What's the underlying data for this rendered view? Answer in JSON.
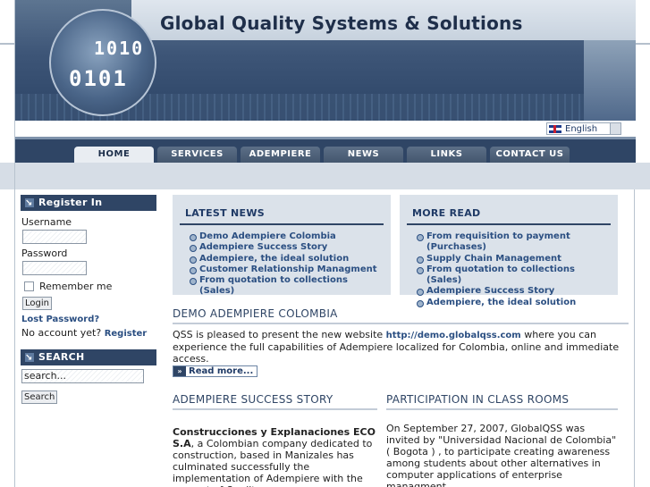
{
  "header": {
    "title": "Global Quality Systems & Solutions",
    "binary_line1": "1010",
    "binary_line2": "0101"
  },
  "language": {
    "selected": "English",
    "flag_icon": "uk-flag-icon"
  },
  "nav": {
    "tabs": [
      {
        "label": "HOME",
        "active": true
      },
      {
        "label": "SERVICES"
      },
      {
        "label": "ADEMPIERE"
      },
      {
        "label": "NEWS"
      },
      {
        "label": "LINKS"
      },
      {
        "label": "CONTACT US"
      }
    ]
  },
  "login": {
    "heading": "Register In",
    "username_label": "Username",
    "password_label": "Password",
    "remember_label": "Remember me",
    "login_button": "Login",
    "lost_password": "Lost Password?",
    "no_account": "No account yet?",
    "register_link": "Register"
  },
  "search": {
    "heading": "SEARCH",
    "placeholder": "search...",
    "button": "Search"
  },
  "latest_news": {
    "title": "LATEST NEWS",
    "items": [
      "Demo Adempiere Colombia",
      "Adempiere Success Story",
      "Adempiere, the ideal solution",
      "Customer Relationship Managment",
      "From quotation to collections (Sales)"
    ]
  },
  "more_read": {
    "title": "MORE READ",
    "items": [
      "From requisition to payment (Purchases)",
      "Supply Chain Management",
      "From quotation to collections (Sales)",
      "Adempiere Success Story",
      "Adempiere, the ideal solution"
    ]
  },
  "article_demo": {
    "title": "DEMO ADEMPIERE COLOMBIA",
    "text_before": "QSS is pleased to present the new website ",
    "link": "http://demo.globalqss.com",
    "text_after": " where you can experience the full capabilities of Adempiere localized for Colombia, online and immediate access.",
    "read_more": "Read more..."
  },
  "article_success": {
    "title": "ADEMPIERE SUCCESS STORY",
    "company": "Construcciones y Explanaciones ECO S.A",
    "text": ", a Colombian company dedicated to construction, based in Manizales has culminated successfully the implementation of Adempiere with the support of Quality"
  },
  "article_class": {
    "title": "PARTICIPATION IN CLASS ROOMS",
    "text": "On September 27, 2007, GlobalQSS was invited by \"Universidad Nacional de Colombia\" ( Bogota ) , to participate creating awareness among students about  other alternatives in computer applications of enterprise managment"
  }
}
